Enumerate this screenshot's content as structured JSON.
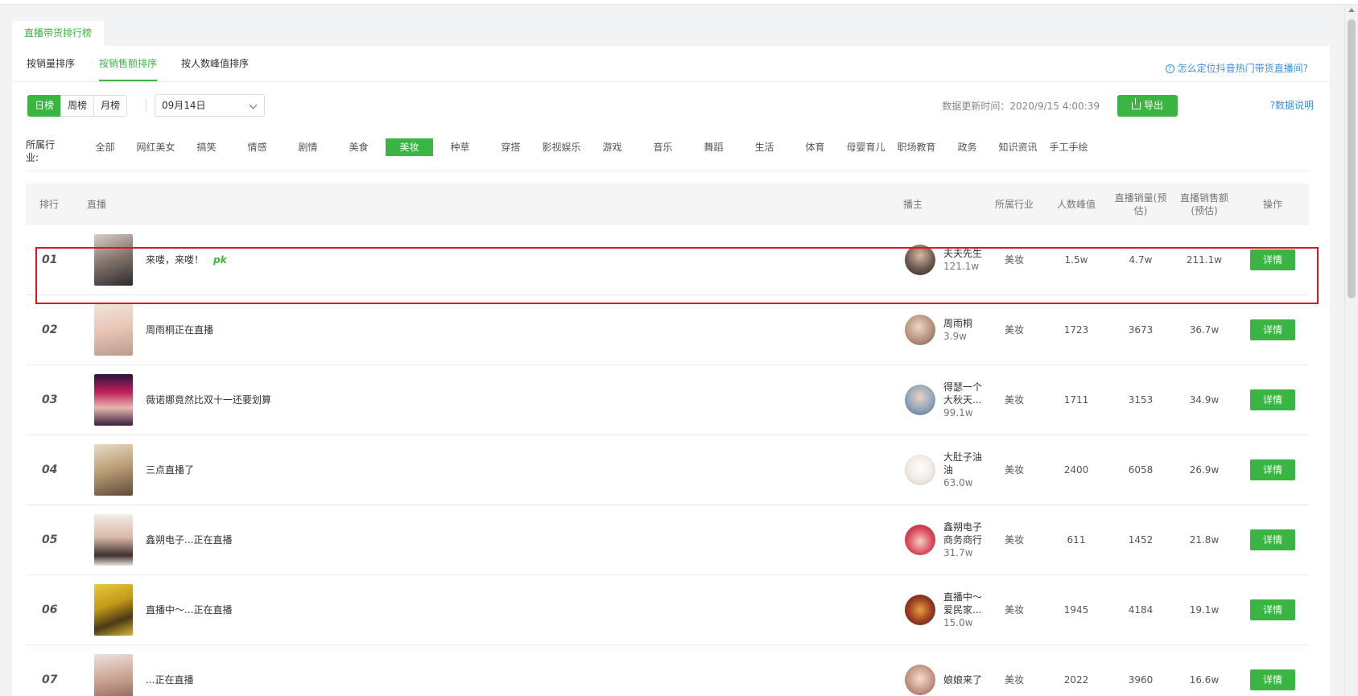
{
  "page_tab": "直播带货排行榜",
  "sort_tabs": [
    {
      "label": "按销量排序",
      "active": false
    },
    {
      "label": "按销售额排序",
      "active": true
    },
    {
      "label": "按人数峰值排序",
      "active": false
    }
  ],
  "help_link": "怎么定位抖音热门带货直播间?",
  "period": [
    "日榜",
    "周榜",
    "月榜"
  ],
  "date_value": "09月14日",
  "update_time": "数据更新时间：2020/9/15 4:00:39",
  "export_label": "导出",
  "data_note_label": "数据说明",
  "industry_label": "所属行业:",
  "industries": [
    "全部",
    "网红美女",
    "搞笑",
    "情感",
    "剧情",
    "美食",
    "美妆",
    "种草",
    "穿搭",
    "影视娱乐",
    "游戏",
    "音乐",
    "舞蹈",
    "生活",
    "体育",
    "母婴育儿",
    "职场教育",
    "政务",
    "知识资讯",
    "手工手绘"
  ],
  "active_industry": "美妆",
  "columns": {
    "rank": "排行",
    "live": "直播",
    "anchor": "播主",
    "industry": "所属行业",
    "peak": "人数峰值",
    "volume": "直播销量(预估)",
    "amount": "直播销售额(预估)",
    "action": "操作"
  },
  "detail_label": "详情",
  "rows": [
    {
      "rank": "01",
      "title": "来喽，来喽！",
      "pk": "pk",
      "anchor": "夫夫先生",
      "fans": "121.1w",
      "industry": "美妆",
      "peak": "1.5w",
      "volume": "4.7w",
      "amount": "211.1w"
    },
    {
      "rank": "02",
      "title": "周雨桐正在直播",
      "pk": "",
      "anchor": "周雨桐",
      "fans": "3.9w",
      "industry": "美妆",
      "peak": "1723",
      "volume": "3673",
      "amount": "36.7w"
    },
    {
      "rank": "03",
      "title": "薇诺娜竟然比双十一还要划算",
      "pk": "",
      "anchor": "得瑟一个大秋天...",
      "fans": "99.1w",
      "industry": "美妆",
      "peak": "1711",
      "volume": "3153",
      "amount": "34.9w"
    },
    {
      "rank": "04",
      "title": "三点直播了",
      "pk": "",
      "anchor": "大肚子油油",
      "fans": "63.0w",
      "industry": "美妆",
      "peak": "2400",
      "volume": "6058",
      "amount": "26.9w"
    },
    {
      "rank": "05",
      "title": "鑫朔电子...正在直播",
      "pk": "",
      "anchor": "鑫朔电子商务商行",
      "fans": "31.7w",
      "industry": "美妆",
      "peak": "611",
      "volume": "1452",
      "amount": "21.8w"
    },
    {
      "rank": "06",
      "title": "直播中～...正在直播",
      "pk": "",
      "anchor": "直播中～爱民家...",
      "fans": "15.0w",
      "industry": "美妆",
      "peak": "1945",
      "volume": "4184",
      "amount": "19.1w"
    },
    {
      "rank": "07",
      "title": "...正在直播",
      "pk": "",
      "anchor": "娘娘来了",
      "fans": "",
      "industry": "美妆",
      "peak": "2022",
      "volume": "3960",
      "amount": "16.6w"
    }
  ],
  "colors": {
    "accent": "#3ab544",
    "link": "#3c8fe0",
    "highlight": "#e0141e"
  }
}
